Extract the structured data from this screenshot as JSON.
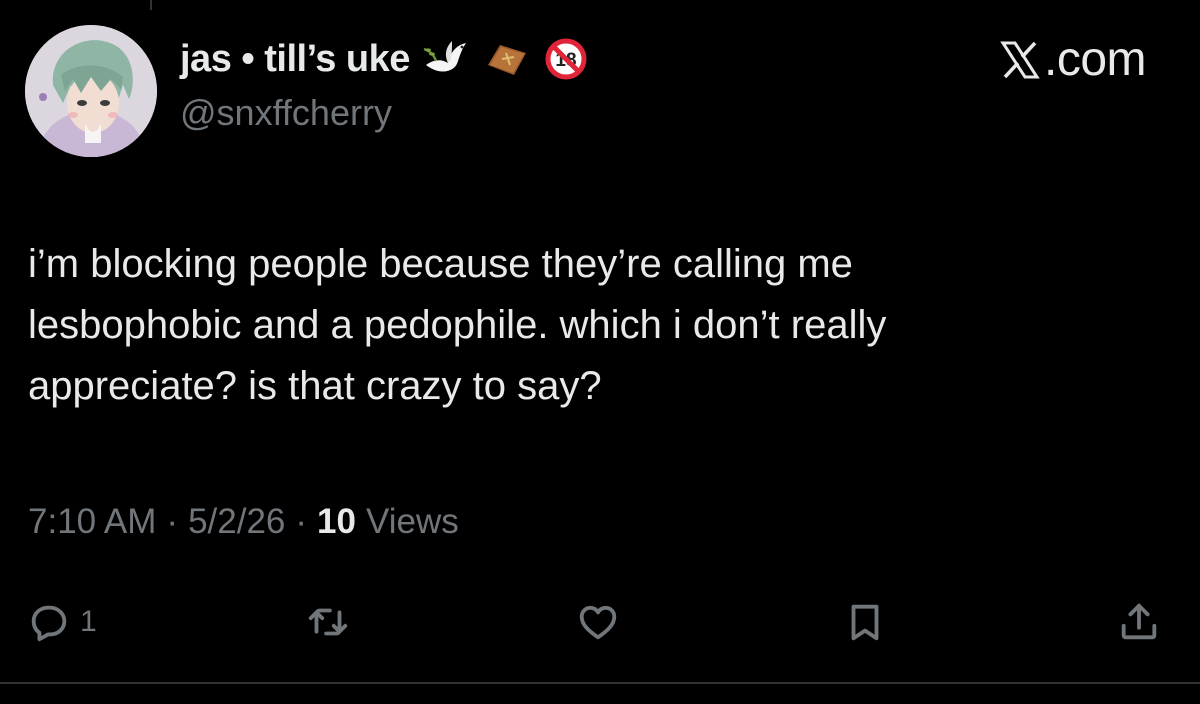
{
  "header": {
    "display_name": "jas • till’s uke",
    "handle": "@snxffcherry",
    "emojis": [
      "dove-emoji",
      "coffin-emoji",
      "no-one-under-eighteen-emoji"
    ],
    "site_label": ".com"
  },
  "tweet": {
    "lines": [
      "i’m blocking people because they’re calling me",
      "lesbophobic and a pedophile. which i don’t really",
      "appreciate? is that crazy to say?"
    ]
  },
  "meta": {
    "time": "7:10 AM",
    "sep1": "·",
    "date": "5/2/26",
    "sep2": "·",
    "views_count": "10",
    "views_label": "Views"
  },
  "actions": {
    "reply_count": "1",
    "icons": [
      "reply-icon",
      "retweet-icon",
      "like-icon",
      "bookmark-icon",
      "share-icon"
    ]
  },
  "colors": {
    "background": "#000000",
    "primary_text": "#e7e9ea",
    "secondary_text": "#71767b",
    "divider": "#2f3336"
  }
}
